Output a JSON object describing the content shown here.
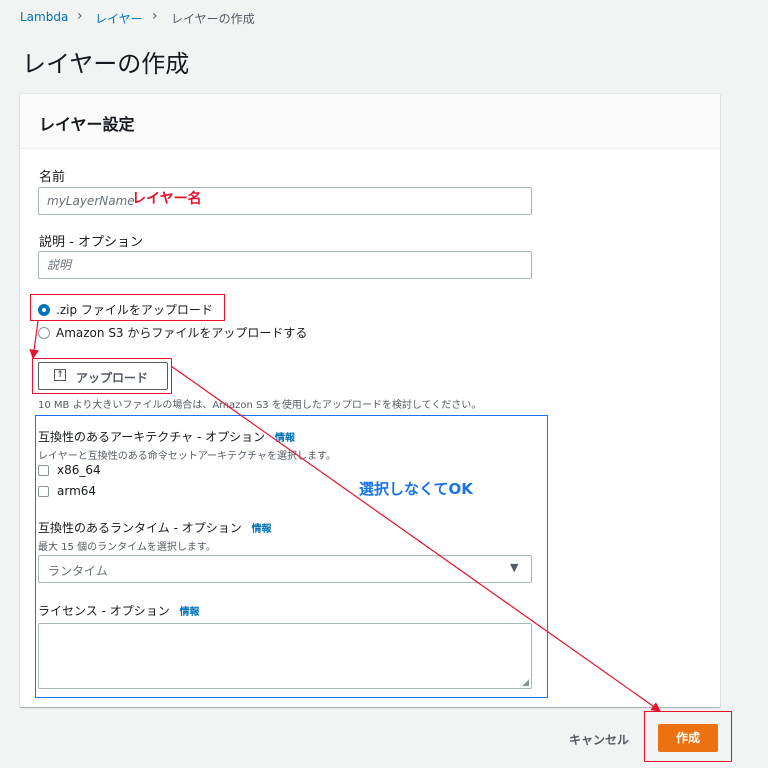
{
  "breadcrumb": {
    "items": [
      "Lambda",
      "レイヤー",
      "レイヤーの作成"
    ]
  },
  "page": {
    "title": "レイヤーの作成"
  },
  "card": {
    "title": "レイヤー設定",
    "name": {
      "label": "名前",
      "placeholder": "myLayerName"
    },
    "description": {
      "label": "説明 - オプション",
      "placeholder": "説明"
    },
    "upload_options": [
      {
        "label": ".zip ファイルをアップロード",
        "selected": true
      },
      {
        "label": "Amazon S3 からファイルをアップロードする",
        "selected": false
      }
    ],
    "upload_button": "アップロード",
    "upload_hint": "10 MB より大きいファイルの場合は、Amazon S3 を使用したアップロードを検討してください。",
    "architecture": {
      "label": "互換性のあるアーキテクチャ - オプション",
      "info": "情報",
      "description": "レイヤーと互換性のある命令セットアーキテクチャを選択します。",
      "options": [
        "x86_64",
        "arm64"
      ]
    },
    "runtime": {
      "label": "互換性のあるランタイム - オプション",
      "info": "情報",
      "description": "最大 15 個のランタイムを選択します。",
      "placeholder": "ランタイム"
    },
    "license": {
      "label": "ライセンス - オプション",
      "info": "情報"
    }
  },
  "footer": {
    "cancel": "キャンセル",
    "create": "作成"
  },
  "annotations": {
    "layer_name": "レイヤー名",
    "no_selection": "選択しなくてOK"
  },
  "colors": {
    "annotation_red": "#e8112d",
    "annotation_blue": "#1a73e8",
    "primary": "#ec7211",
    "link": "#0073bb"
  }
}
